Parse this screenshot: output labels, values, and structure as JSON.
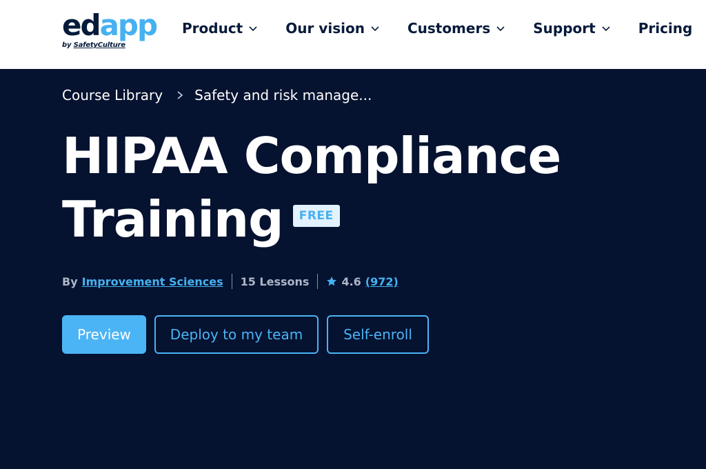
{
  "logo": {
    "name_part1": "ed",
    "name_part2": "app",
    "by_prefix": "by ",
    "by_brand": "SafetyCulture"
  },
  "nav": {
    "items": [
      {
        "label": "Product",
        "has_dropdown": true
      },
      {
        "label": "Our vision",
        "has_dropdown": true
      },
      {
        "label": "Customers",
        "has_dropdown": true
      },
      {
        "label": "Support",
        "has_dropdown": true
      },
      {
        "label": "Pricing",
        "has_dropdown": false
      }
    ]
  },
  "breadcrumb": {
    "root": "Course Library",
    "current": "Safety and risk manage..."
  },
  "course": {
    "title": "HIPAA Compliance Training",
    "badge": "FREE",
    "by_label": "By",
    "author": "Improvement Sciences",
    "lessons": "15 Lessons",
    "rating": "4.6",
    "rating_count": "(972)"
  },
  "actions": {
    "preview": "Preview",
    "deploy": "Deploy to my team",
    "self_enroll": "Self-enroll"
  },
  "colors": {
    "navy": "#051230",
    "accent": "#46b1f0",
    "header_bg": "#ffffff",
    "nav_text": "#061a3a"
  },
  "icons": {
    "dropdown": "chevron-down-icon",
    "breadcrumb_sep": "chevron-right-icon",
    "rating": "star-icon"
  }
}
